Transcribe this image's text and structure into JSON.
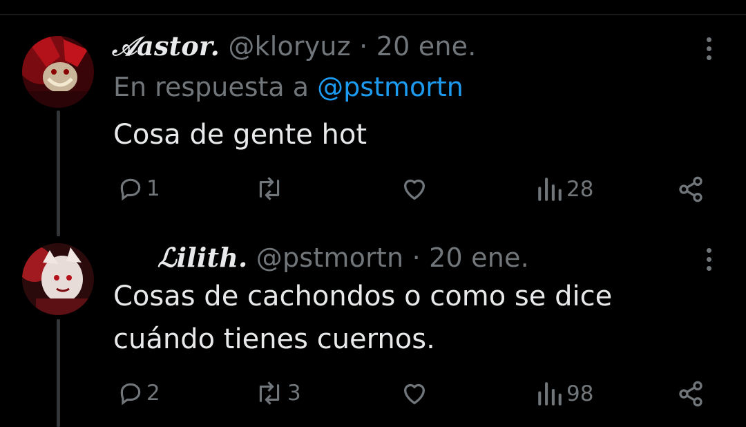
{
  "tweets": [
    {
      "display_name": "𝒜astor.",
      "handle": "@kloryuz",
      "date": "· 20 ene.",
      "reply_prefix": "En respuesta a",
      "reply_handle": "@pstmortn",
      "text": "Cosa de gente hot",
      "replies": "1",
      "retweets": "",
      "likes": "",
      "views": "28"
    },
    {
      "display_name": "ℒilith.",
      "handle": "@pstmortn",
      "date": "· 20 ene.",
      "text_line1": "Cosas de cachondos o como se dice",
      "text_line2": "cuándo tienes cuernos.",
      "replies": "2",
      "retweets": "3",
      "likes": "",
      "views": "98"
    }
  ],
  "icons": [
    "reply-icon",
    "retweet-icon",
    "like-icon",
    "views-icon",
    "share-icon",
    "more-icon"
  ],
  "colors": {
    "background": "#000000",
    "text": "#e7e9ea",
    "muted": "#71767b",
    "mention": "#1d9bf0"
  }
}
